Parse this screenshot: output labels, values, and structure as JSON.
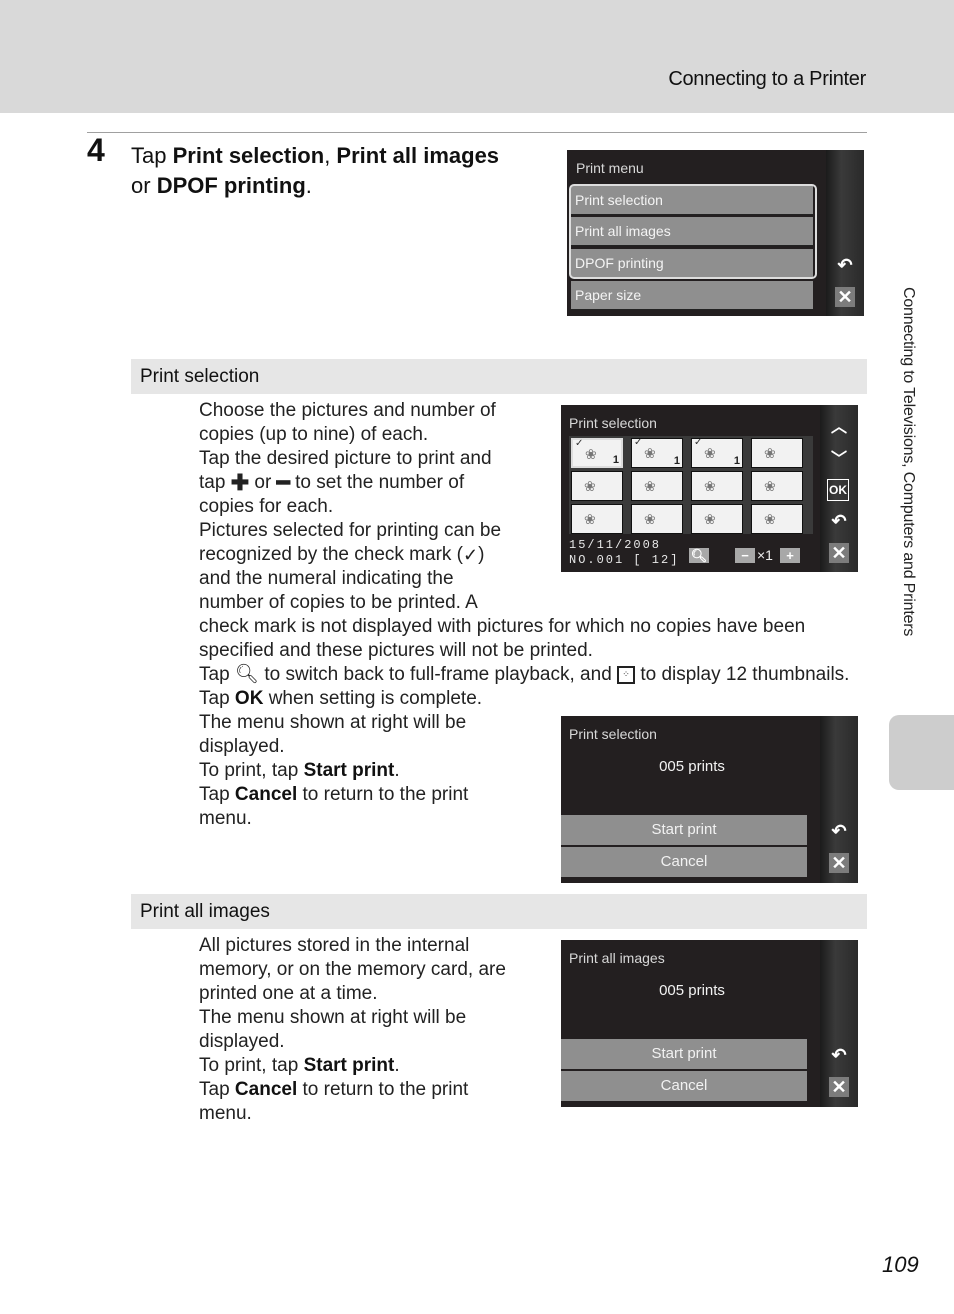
{
  "header": {
    "section_title": "Connecting to a Printer"
  },
  "step": {
    "number": "4",
    "text_prefix": "Tap ",
    "opt1": "Print selection",
    "sep1": ", ",
    "opt2": "Print all images",
    "sep2": " or ",
    "opt3": "DPOF printing",
    "suffix": "."
  },
  "print_menu_screen": {
    "title": "Print menu",
    "items": [
      "Print selection",
      "Print all images",
      "DPOF printing",
      "Paper size"
    ],
    "icons": [
      "back-icon",
      "close-icon"
    ]
  },
  "sections": {
    "print_selection": {
      "heading": "Print selection",
      "lines": [
        "Choose the pictures and number of",
        "copies (up to nine) of each.",
        "Tap the desired picture to print and",
        "copies for each.",
        "Pictures selected for printing can be",
        "and the numeral indicating the",
        "number of copies to be printed. A",
        "check mark is not displayed with pictures for which no copies have been",
        "specified and these pictures will not be printed.",
        "The menu shown at right will be",
        "displayed.",
        "menu."
      ],
      "tap_plus_line": {
        "a": "tap ",
        "b": " or ",
        "c": " to set the number of"
      },
      "check_line": {
        "a": "recognized by the check mark (",
        "b": ")"
      },
      "zoom_line": {
        "a": "Tap ",
        "b": " to switch back to full-frame playback, and ",
        "c": " to display 12 thumbnails."
      },
      "ok_line": {
        "a": "Tap ",
        "b": " when setting is complete."
      },
      "start_line": {
        "a": "To print, tap ",
        "b": "Start print",
        "c": "."
      },
      "cancel_line": {
        "a": "Tap ",
        "b": "Cancel",
        "c": " to return to the print"
      }
    },
    "print_all": {
      "heading": "Print all images",
      "lines": [
        "All pictures stored in the internal",
        "memory, or on the memory card, are",
        "printed one at a time.",
        "The menu shown at right will be",
        "displayed.",
        "menu."
      ],
      "start_line": {
        "a": "To print, tap ",
        "b": "Start print",
        "c": "."
      },
      "cancel_line": {
        "a": "Tap ",
        "b": "Cancel",
        "c": " to return to the print"
      }
    }
  },
  "print_selection_screen": {
    "title": "Print selection",
    "thumbnails": [
      {
        "selected": true,
        "checked": true,
        "copies": "1"
      },
      {
        "selected": false,
        "checked": true,
        "copies": "1"
      },
      {
        "selected": false,
        "checked": true,
        "copies": "1"
      },
      {
        "selected": false,
        "checked": false,
        "copies": ""
      },
      {
        "selected": false,
        "checked": false,
        "copies": ""
      },
      {
        "selected": false,
        "checked": false,
        "copies": ""
      },
      {
        "selected": false,
        "checked": false,
        "copies": ""
      },
      {
        "selected": false,
        "checked": false,
        "copies": ""
      },
      {
        "selected": false,
        "checked": false,
        "copies": ""
      },
      {
        "selected": false,
        "checked": false,
        "copies": ""
      },
      {
        "selected": false,
        "checked": false,
        "copies": ""
      },
      {
        "selected": false,
        "checked": false,
        "copies": ""
      }
    ],
    "date": "15/11/2008",
    "file_no": "NO.001 [   12]",
    "copies_label": "×1",
    "minus": "−",
    "plus": "+",
    "ok_label": "OK"
  },
  "confirm_screen_selection": {
    "title": "Print selection",
    "count": "005 prints",
    "start_label": "Start print",
    "cancel_label": "Cancel"
  },
  "confirm_screen_all": {
    "title": "Print all images",
    "count": "005 prints",
    "start_label": "Start print",
    "cancel_label": "Cancel"
  },
  "side_tab": {
    "label": "Connecting to Televisions, Computers and Printers"
  },
  "page_number": "109"
}
